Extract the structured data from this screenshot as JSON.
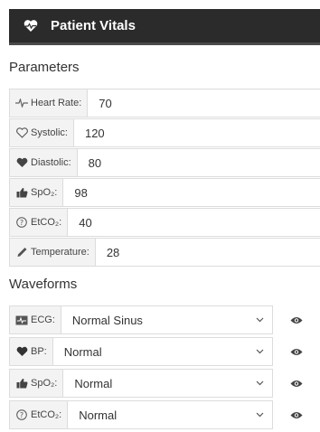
{
  "header": {
    "title": "Patient Vitals",
    "icon": "heart-pulse-icon"
  },
  "parameters": {
    "title": "Parameters",
    "items": [
      {
        "label": "Heart Rate:",
        "value": "70",
        "icon": "pulse-line-icon"
      },
      {
        "label": "Systolic:",
        "value": "120",
        "icon": "heart-outline-icon"
      },
      {
        "label": "Diastolic:",
        "value": "80",
        "icon": "heart-solid-icon"
      },
      {
        "label": "SpO₂:",
        "value": "98",
        "icon": "thumbs-up-icon"
      },
      {
        "label": "EtCO₂:",
        "value": "40",
        "icon": "question-circle-icon"
      },
      {
        "label": "Temperature:",
        "value": "28",
        "icon": "thermometer-icon"
      }
    ]
  },
  "waveforms": {
    "title": "Waveforms",
    "items": [
      {
        "label": "ECG:",
        "value": "Normal Sinus",
        "icon": "monitor-icon"
      },
      {
        "label": "BP:",
        "value": "Normal",
        "icon": "heart-solid-icon"
      },
      {
        "label": "SpO₂:",
        "value": "Normal",
        "icon": "thumbs-up-icon"
      },
      {
        "label": "EtCO₂:",
        "value": "Normal",
        "icon": "question-circle-icon"
      }
    ]
  }
}
